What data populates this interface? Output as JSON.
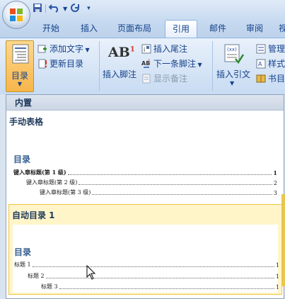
{
  "tabs": [
    "开始",
    "插入",
    "页面布局",
    "引用",
    "邮件",
    "审阅",
    "视"
  ],
  "active_tab": "引用",
  "ribbon": {
    "toc_label": "目录",
    "add_text": "添加文字",
    "update_toc": "更新目录",
    "insert_footnote": "插入脚注",
    "footnote_icon_text": "AB",
    "insert_endnote": "插入尾注",
    "next_footnote": "下一条脚注",
    "show_notes": "显示备注",
    "insert_citation": "插入引文",
    "manage": "管理",
    "style": "样式",
    "bibliography": "书目"
  },
  "dropdown": {
    "section_label": "内置",
    "manual": {
      "title": "手动表格",
      "heading": "目录",
      "lines": [
        {
          "text": "键入章标题(第 1 级)",
          "page": "1"
        },
        {
          "text": "键入章标题(第 2 级)",
          "page": "2"
        },
        {
          "text": "键入章标题(第 3 级)",
          "page": "3"
        }
      ]
    },
    "auto1": {
      "title": "自动目录 1",
      "heading": "目录",
      "lines": [
        {
          "text": "标题 1",
          "page": "1"
        },
        {
          "text": "标题 2",
          "page": "1"
        },
        {
          "text": "标题 3",
          "page": "1"
        }
      ]
    }
  }
}
